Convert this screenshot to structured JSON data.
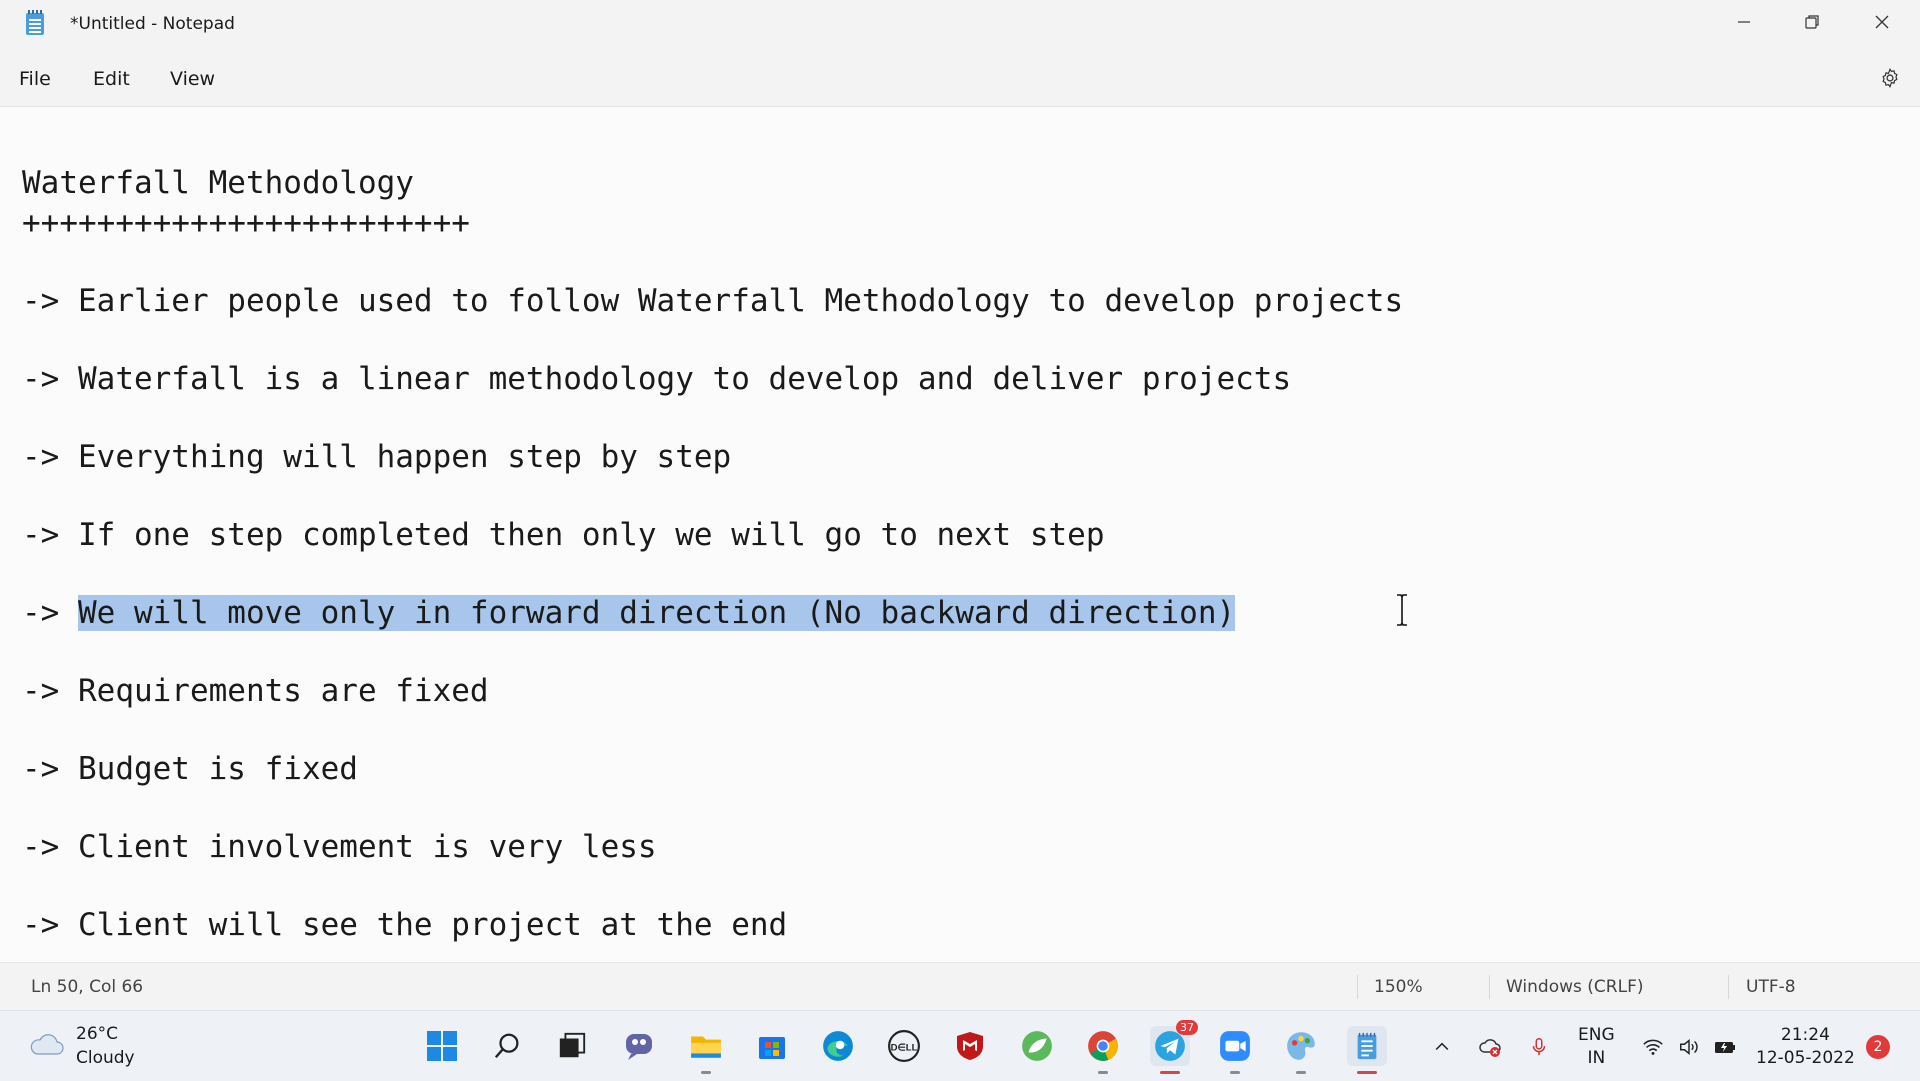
{
  "window": {
    "title": "*Untitled - Notepad",
    "app_icon": "notepad-icon",
    "controls": [
      "minimize-icon",
      "restore-icon",
      "close-icon"
    ]
  },
  "menu": {
    "file": "File",
    "edit": "Edit",
    "view": "View",
    "settings_icon": "gear-icon"
  },
  "editor": {
    "lines": [
      "Waterfall Methodology",
      "++++++++++++++++++++++++",
      "-> Earlier people used to follow Waterfall Methodology to develop projects",
      "-> Waterfall is a linear methodology to develop and deliver projects",
      "-> Everything will happen step by step",
      "-> If one step completed then only we will go to next step",
      "-> ",
      "-> Requirements are fixed",
      "-> Budget is fixed",
      "-> Client involvement is very less",
      "-> Client will see the project at the end"
    ],
    "selected_text": "We will move only in forward direction (No backward direction)"
  },
  "status": {
    "position": "Ln 50, Col 66",
    "zoom": "150%",
    "line_ending": "Windows (CRLF)",
    "encoding": "UTF-8"
  },
  "taskbar": {
    "weather_temp": "26°C",
    "weather_cond": "Cloudy",
    "apps": [
      "windows-start-icon",
      "search-icon",
      "task-view-icon",
      "chat-icon",
      "file-explorer-icon",
      "microsoft-store-icon",
      "edge-icon",
      "dell-icon",
      "mcafee-icon",
      "leaf-app-icon",
      "chrome-icon",
      "telegram-icon",
      "zoom-icon",
      "paint-icon",
      "notepad-icon"
    ],
    "telegram_badge": "37",
    "lang_1": "ENG",
    "lang_2": "IN",
    "time": "21:24",
    "date": "12-05-2022",
    "notifications": "2"
  },
  "colors": {
    "selection": "#a8c6ec",
    "accent": "#0067c0"
  }
}
